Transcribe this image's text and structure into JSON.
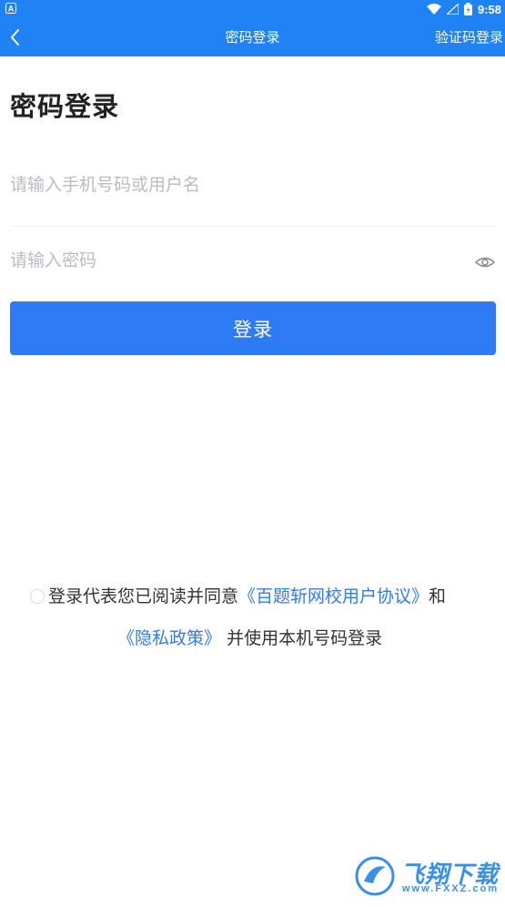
{
  "status_bar": {
    "time": "9:58",
    "icons": [
      "wifi-icon",
      "signal-icon",
      "battery-icon"
    ]
  },
  "nav": {
    "title": "密码登录",
    "right_link": "验证码登录"
  },
  "heading": "密码登录",
  "form": {
    "username_placeholder": "请输入手机号码或用户名",
    "username_value": "",
    "password_placeholder": "请输入密码",
    "password_value": "",
    "login_label": "登录"
  },
  "agreement": {
    "checked": false,
    "prefix": "登录代表您已阅读并同意",
    "user_agreement": "《百题斩网校用户协议》",
    "conjunction": "和",
    "privacy_policy": "《隐私政策》",
    "suffix": "并使用本机号码登录"
  },
  "watermark": {
    "brand": "飞翔下载",
    "url": "www.FXXZ.com"
  },
  "colors": {
    "primary": "#1f82f5",
    "button": "#2f7bf6",
    "link": "#2f7bf6",
    "placeholder": "#b9bcc2"
  }
}
